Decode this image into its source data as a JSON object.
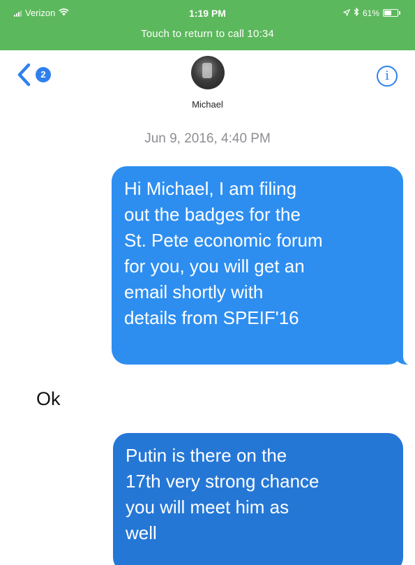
{
  "status_bar": {
    "carrier": "Verizon",
    "time": "1:19 PM",
    "battery_percent": "61%",
    "return_to_call": "Touch to return to call 10:34",
    "color": "#5cb85c",
    "wifi_icon": "wifi-icon",
    "location_icon": "location-arrow-icon",
    "bluetooth_icon": "bluetooth-icon"
  },
  "header": {
    "back_badge_count": "2",
    "contact_name": "Michael",
    "info_label": "i",
    "accent_color": "#2f80ed"
  },
  "conversation": {
    "timestamp": "Jun 9, 2016, 4:40 PM",
    "messages": [
      {
        "direction": "outgoing",
        "text": "Hi Michael, I am filing\nout the badges for the\nSt. Pete economic forum\nfor you, you will get an\nemail shortly with\ndetails from SPEIF'16"
      },
      {
        "direction": "incoming",
        "text": "Ok"
      },
      {
        "direction": "outgoing",
        "text": "Putin is there on the\n17th very strong chance\nyou will meet him as\nwell"
      }
    ],
    "bubble_color": "#2d8ef0"
  }
}
